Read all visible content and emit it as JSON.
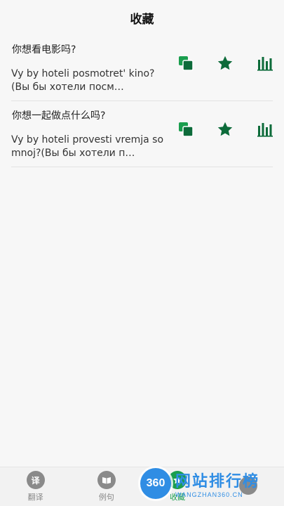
{
  "header": {
    "title": "收藏"
  },
  "items": [
    {
      "source": "你想看电影吗?",
      "translation": "Vy by hoteli posmotret' kino?(Вы бы хотели посм…"
    },
    {
      "source": "你想一起做点什么吗?",
      "translation": "Vy by hoteli provesti vremja so mnoj?(Вы бы хотели п…"
    }
  ],
  "actions": {
    "copy_icon": "copy-icon",
    "favorite_icon": "star-icon",
    "audio_icon": "waveform-icon"
  },
  "tabbar": {
    "tabs": [
      {
        "icon_char": "译",
        "label": "翻译",
        "active": false
      },
      {
        "icon_char": "",
        "label": "例句",
        "active": false
      },
      {
        "icon_char": "",
        "label": "收藏",
        "active": true
      },
      {
        "icon_char": "",
        "label": "",
        "active": false
      }
    ]
  },
  "watermark": {
    "badge": "360",
    "main": "网站排行榜",
    "sub": "WANGZHAN360.CN"
  },
  "colors": {
    "accent": "#1a9e4e",
    "icon_dark_green": "#0d6b3a",
    "watermark_blue": "#2f8de4"
  }
}
